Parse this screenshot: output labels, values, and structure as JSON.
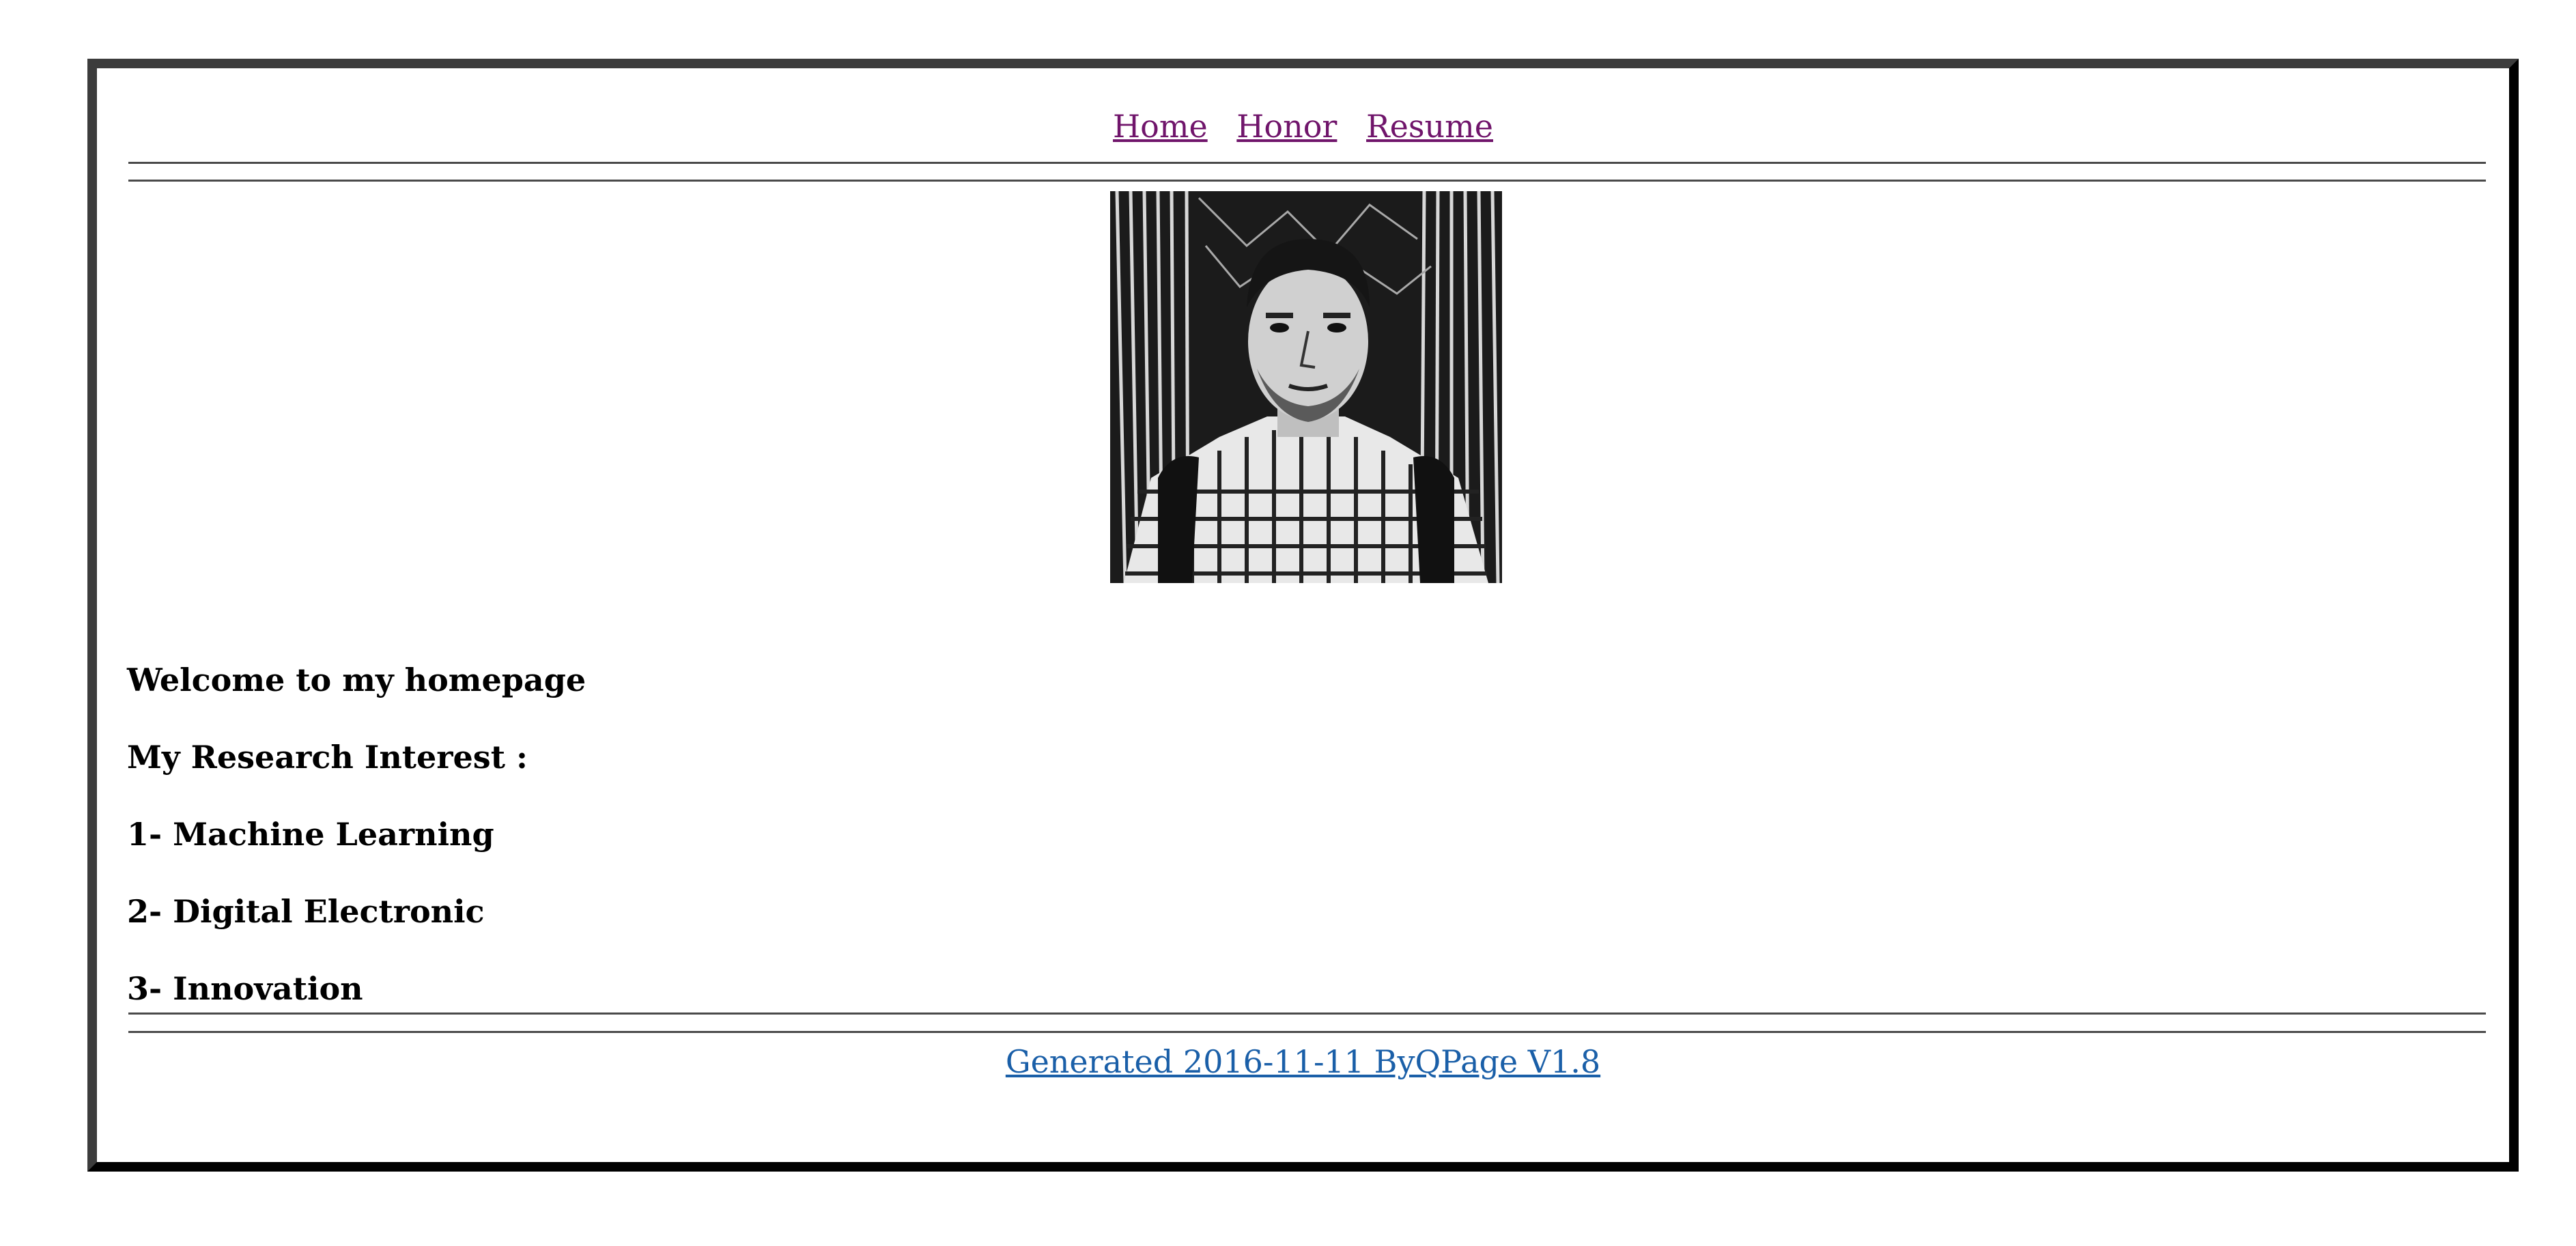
{
  "nav": {
    "links": [
      "Home",
      "Honor",
      "Resume"
    ]
  },
  "photo": {
    "alt": "profile photo",
    "style": "black and white sketch portrait"
  },
  "content": {
    "welcome": "Welcome to my homepage",
    "research_heading": "My Research Interest :",
    "interests": [
      "1- Machine Learning",
      "2- Digital Electronic",
      "3- Innovation"
    ]
  },
  "footer": {
    "text": "Generated 2016-11-11 ByQPage V1.8"
  },
  "colors": {
    "visited_link": "#70156b",
    "footer_link": "#1a5fa8",
    "frame_border": "#3c3c3c"
  }
}
